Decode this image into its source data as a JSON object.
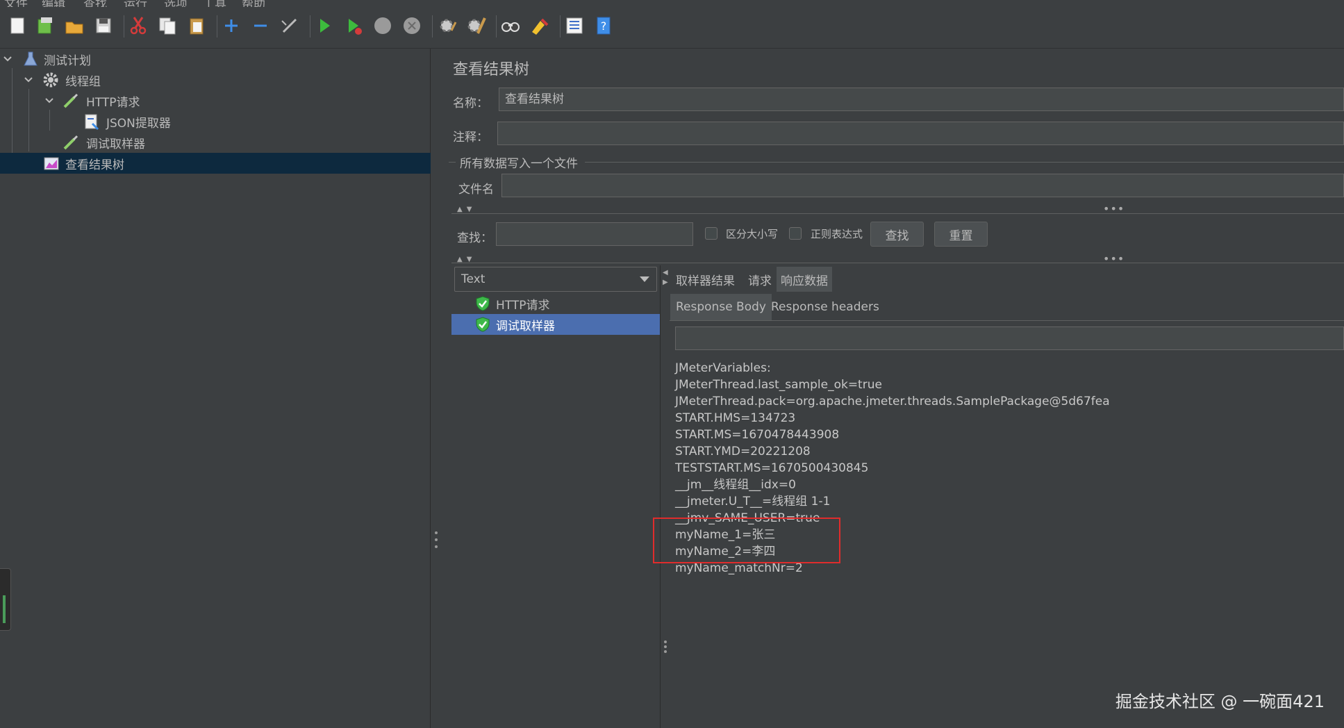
{
  "menu": {
    "items": [
      "文件",
      "编辑",
      "查找",
      "运行",
      "选项",
      "工具",
      "帮助"
    ]
  },
  "toolbar": {
    "icons": [
      "new-icon",
      "templates-icon",
      "open-icon",
      "save-icon",
      "cut-icon",
      "copy-icon",
      "paste-icon",
      "expand-icon",
      "collapse-icon",
      "toggle-icon",
      "start-icon",
      "start-no-pause-icon",
      "stop-icon",
      "shutdown-icon",
      "clear-icon",
      "clear-all-icon",
      "search-icon",
      "reset-search-icon",
      "function-helper-icon",
      "help-icon"
    ]
  },
  "tree": {
    "items": [
      {
        "label": "测试计划",
        "icon": "test-plan-icon"
      },
      {
        "label": "线程组",
        "icon": "thread-group-gear-icon"
      },
      {
        "label": "HTTP请求",
        "icon": "http-sampler-pipette-icon"
      },
      {
        "label": "JSON提取器",
        "icon": "json-extractor-icon"
      },
      {
        "label": "调试取样器",
        "icon": "debug-sampler-pipette-icon"
      },
      {
        "label": "查看结果树",
        "icon": "results-tree-chart-icon"
      }
    ]
  },
  "panel": {
    "title": "查看结果树",
    "name_label": "名称：",
    "name_value": "查看结果树",
    "comment_label": "注释：",
    "comment_value": "",
    "file_group_title": "所有数据写入一个文件",
    "filename_label": "文件名",
    "filename_value": "",
    "search_label": "查找：",
    "search_value": "",
    "case_sensitive_label": "区分大小写",
    "regex_label": "正则表达式",
    "find_button": "查找",
    "reset_button": "重置"
  },
  "results": {
    "renderer": "Text",
    "items": [
      {
        "label": "HTTP请求",
        "status": "success"
      },
      {
        "label": "调试取样器",
        "status": "success"
      }
    ],
    "tabs": [
      "取样器结果",
      "请求",
      "响应数据"
    ],
    "active_tab": "响应数据",
    "subtabs": [
      "Response Body",
      "Response headers"
    ],
    "active_subtab": "Response Body",
    "body_lines": [
      "JMeterVariables:",
      "JMeterThread.last_sample_ok=true",
      "JMeterThread.pack=org.apache.jmeter.threads.SamplePackage@5d67fea",
      "START.HMS=134723",
      "START.MS=1670478443908",
      "START.YMD=20221208",
      "TESTSTART.MS=1670500430845",
      "__jm__线程组__idx=0",
      "__jmeter.U_T__=线程组 1-1",
      "__jmv_SAME_USER=true",
      "myName_1=张三",
      "myName_2=李四",
      "myName_matchNr=2"
    ]
  },
  "watermark": "掘金技术社区 @ 一碗面421",
  "colors": {
    "background": "#3c3f41",
    "selection": "#0d293e",
    "list_selection": "#4b6eaf",
    "highlight": "#e02c2c",
    "text": "#bbbbbb"
  }
}
